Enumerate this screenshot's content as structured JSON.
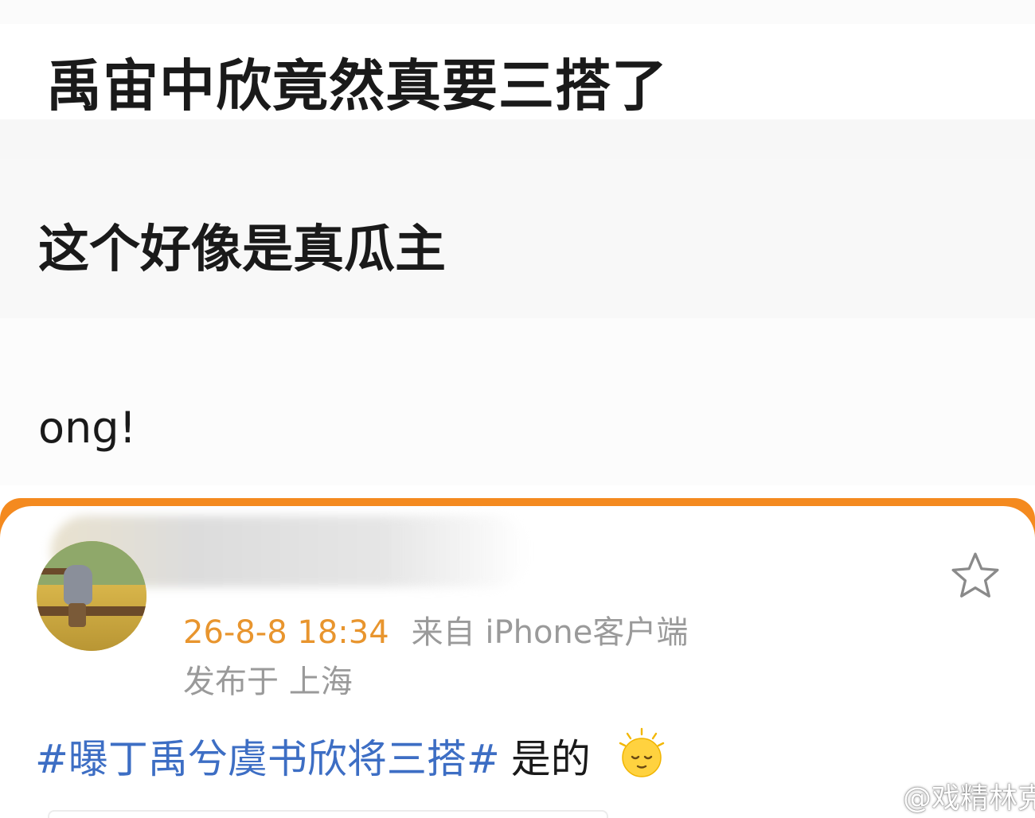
{
  "post_overlay": {
    "headline": "禹宙中欣竟然真要三搭了",
    "subline": "这个好像是真瓜主",
    "fragment": "ong!"
  },
  "post_card": {
    "timestamp": "26-8-8 18:34",
    "source": "来自 iPhone客户端",
    "location": "发布于 上海",
    "hashtag": "#曝丁禹兮虞书欣将三搭#",
    "text": "是的",
    "emoji": "sleepy-face",
    "favorite_icon": "star-outline-icon"
  },
  "watermark": {
    "text": "@戏精林克"
  },
  "colors": {
    "accent_orange": "#f48a1f",
    "timestamp_orange": "#e8952e",
    "hashtag_blue": "#3d6ec4",
    "meta_gray": "#9a9a9a"
  }
}
